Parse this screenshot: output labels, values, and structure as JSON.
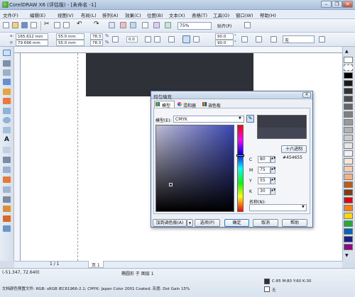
{
  "window": {
    "title": "CorelDRAW X6 (评估版) - [未命名 -1]",
    "minimize": "–",
    "restore": "❐",
    "close": "✕"
  },
  "menu": [
    "文件(F)",
    "编辑(E)",
    "视图(V)",
    "布局(L)",
    "排列(A)",
    "效果(C)",
    "位图(B)",
    "文本(X)",
    "表格(T)",
    "工具(O)",
    "窗口(W)",
    "帮助(H)"
  ],
  "toolbar": {
    "zoom": "75%",
    "snap_label": "贴齐(P)"
  },
  "properties": {
    "x": "165.612 mm",
    "y": "79.696 mm",
    "width": "55.0 mm",
    "height": "55.0 mm",
    "scale_w": "78.3",
    "scale_h": "78.3",
    "scale_unit": "%",
    "angle": "0.0",
    "corner1": "90.0",
    "corner2": "90.0",
    "corner_unit": "°",
    "outline": "无"
  },
  "page_tabs": {
    "counter": "1 / 1",
    "tab": "页 1"
  },
  "status": {
    "coords": "(-51.347, 72.640)",
    "object_info": "椭圆形 于 图层 1",
    "color_profile": "文档颜色预置文件: RGB: sRGB IEC61966-2.1; CMYK: Japan Color 2001 Coated; 灰度: Dot Gain 15%",
    "fill_info": "C:85 M:80 Y:60 K:30",
    "outline_info": "无"
  },
  "dialog": {
    "title": "均匀填充",
    "tabs": [
      "模型",
      "混和器",
      "调色板"
    ],
    "model_label": "模型(E):",
    "model_value": "CMYK",
    "hex_button": "十六进制",
    "hex_value": "#454655",
    "c_label": "C",
    "c_value": "80",
    "m_label": "M",
    "m_value": "75",
    "y_label": "Y",
    "y_value": "55",
    "k_label": "K",
    "k_value": "30",
    "name_label": "名称(N):",
    "add_palette": "加到调色板(A)",
    "options": "选项(P)",
    "ok": "确定",
    "cancel": "取消",
    "help": "帮助"
  },
  "colors": {
    "selected_fill": "#454655",
    "rect_fill": "#2e3138"
  },
  "icons": [
    "pick-tool-icon",
    "shape-tool-icon",
    "crop-tool-icon",
    "zoom-tool-icon",
    "freehand-tool-icon",
    "smart-fill-icon",
    "rectangle-tool-icon",
    "ellipse-tool-icon",
    "polygon-tool-icon",
    "text-tool-icon",
    "table-tool-icon",
    "dimension-tool-icon",
    "connector-tool-icon",
    "blend-tool-icon",
    "transparency-tool-icon",
    "eyedropper-tool-icon",
    "outline-tool-icon",
    "fill-tool-icon",
    "interactive-fill-icon"
  ]
}
